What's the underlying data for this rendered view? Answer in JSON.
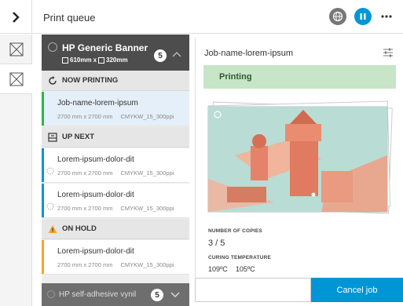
{
  "header": {
    "title": "Print queue",
    "back_icon": "chevron-right-icon",
    "icons": [
      "globe-icon",
      "pause-icon",
      "more-icon"
    ],
    "accent": "#0096d6"
  },
  "rail": {
    "items": [
      {
        "icon": "placeholder-image-icon",
        "active": false
      },
      {
        "icon": "placeholder-image-icon",
        "active": true
      }
    ]
  },
  "queue": {
    "device": {
      "name": "HP Generic Banner",
      "width": "610mm",
      "separator": "x",
      "length": "320mm",
      "count": "5"
    },
    "sections": {
      "now_printing": "NOW PRINTING",
      "up_next": "UP NEXT",
      "on_hold": "ON HOLD"
    },
    "jobs": [
      {
        "name": "Job-name-lorem-ipsum",
        "size": "2700 mm x 2700 mm",
        "profile": "CMYKW_15_300ppi",
        "status_color": "#2fb34a"
      },
      {
        "name": "Lorem-ipsum-dolor-dit",
        "size": "2700 mm x 2700 mm",
        "profile": "CMYKW_15_300ppi",
        "status_color": "#0096d6"
      },
      {
        "name": "Lorem-ipsum-dolor-dit",
        "size": "2700 mm x 2700 mm",
        "profile": "CMYKW_15_300ppi",
        "status_color": "#0096d6"
      },
      {
        "name": "Lorem-ipsum-dolor-dit",
        "size": "2700 mm x 2700 mm",
        "profile": "CMYKW_15_300ppi",
        "status_color": "#f5a623"
      }
    ],
    "footer": {
      "name": "HP self-adhesive vynil",
      "count": "5"
    }
  },
  "detail": {
    "title": "Job-name-lorem-ipsum",
    "status": "Printing",
    "status_color": "#c6e6c7",
    "copies_label": "NUMBER OF COPIES",
    "copies_value": "3 / 5",
    "curing_label": "CURING TEMPERATURE",
    "curing_values": [
      "109ºC",
      "105ºC"
    ]
  },
  "actions": {
    "cancel_label": "Cancel job"
  }
}
